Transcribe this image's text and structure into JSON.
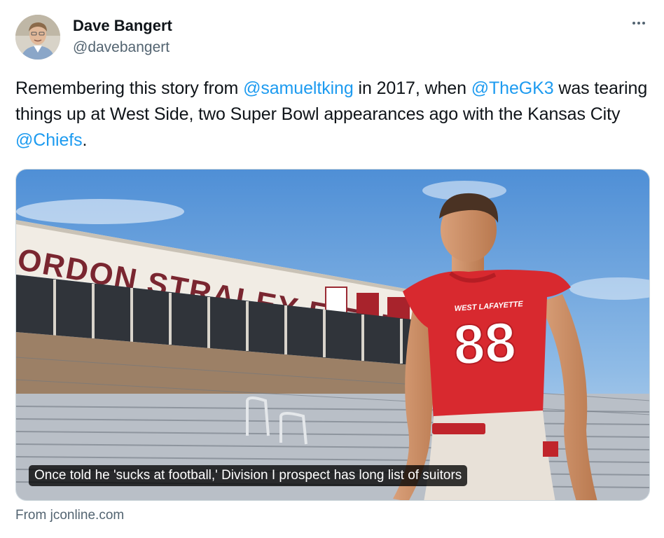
{
  "author": {
    "name": "Dave Bangert",
    "handle": "@davebangert"
  },
  "tweet": {
    "part1": "Remembering this story from ",
    "mention1": "@samueltking",
    "part2": " in 2017, when ",
    "mention2": "@TheGK3",
    "part3": " was tearing things up at West Side, two Super Bowl appearances ago with the Kansas City ",
    "mention3": "@Chiefs",
    "part4": "."
  },
  "card": {
    "stadium_sign": "ORDON STRALEY FIELD",
    "jersey_text": "WEST LAFAYETTE",
    "jersey_number": "88",
    "headline": "Once told he 'sucks at football,' Division I prospect has long list of suitors",
    "source": "From jconline.com"
  },
  "icons": {
    "more": "more-options-icon"
  },
  "colors": {
    "link": "#1d9bf0",
    "secondary_text": "#536471",
    "jersey_red": "#d8292f"
  }
}
